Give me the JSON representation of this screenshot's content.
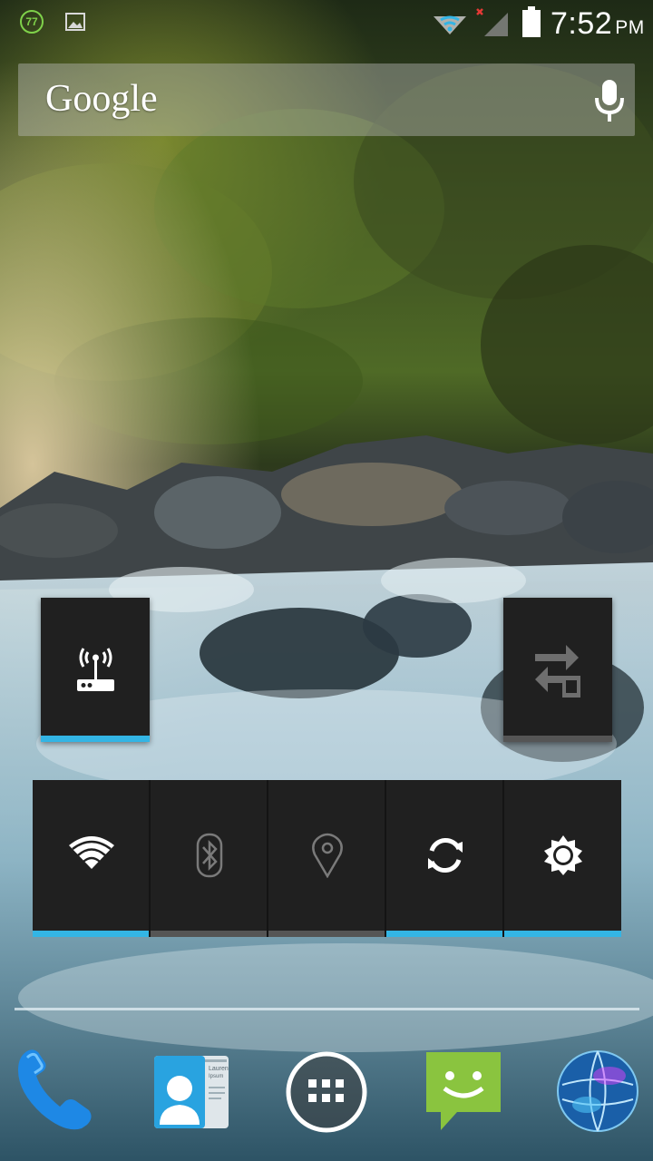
{
  "status_bar": {
    "notification_badge": "77",
    "notification_icons": [
      "update-badge-icon",
      "gallery-icon"
    ],
    "system_icons": [
      "wifi-hotspot-icon",
      "mobile-signal-no-data-icon",
      "battery-icon"
    ],
    "time": "7:52",
    "ampm": "PM"
  },
  "search_bar": {
    "logo_text": "Google",
    "mic_icon": "microphone-icon"
  },
  "widgets": {
    "hotspot": {
      "icon": "wifi-hotspot-router-icon",
      "state": "on"
    },
    "mobile_data": {
      "icon": "mobile-data-transfer-icon",
      "state": "off"
    },
    "power_control": [
      {
        "id": "wifi",
        "icon": "wifi-icon",
        "state": "on"
      },
      {
        "id": "bluetooth",
        "icon": "bluetooth-icon",
        "state": "off"
      },
      {
        "id": "gps",
        "icon": "location-pin-icon",
        "state": "off"
      },
      {
        "id": "sync",
        "icon": "sync-icon",
        "state": "on"
      },
      {
        "id": "brightness",
        "icon": "brightness-icon",
        "state": "on"
      }
    ]
  },
  "dock": {
    "apps": [
      {
        "id": "phone",
        "icon": "phone-icon"
      },
      {
        "id": "contacts",
        "icon": "contacts-icon",
        "card_text": "Lauren Ipsum"
      },
      {
        "id": "all-apps",
        "icon": "app-drawer-icon"
      },
      {
        "id": "messaging",
        "icon": "messaging-icon"
      },
      {
        "id": "browser",
        "icon": "browser-globe-icon"
      }
    ]
  },
  "colors": {
    "accent_on": "#33b5e5",
    "accent_off": "#555555",
    "tile_bg": "#202020",
    "badge_green": "#7fd14a",
    "messaging_green": "#8ac43f"
  }
}
